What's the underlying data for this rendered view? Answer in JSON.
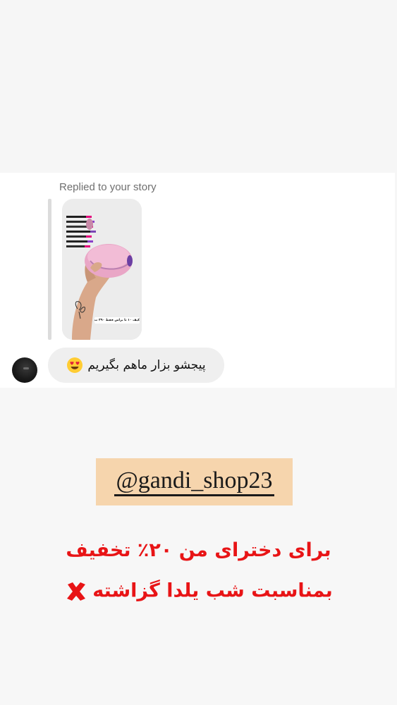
{
  "story_reply": {
    "label": "Replied to your story",
    "story_caption": "کیف ۱۰ تا براش فقط ۳۹۰ ت 😍❌"
  },
  "message": {
    "text": "پیجشو بزار ماهم بگیریم",
    "emoji": "heart-eyes-emoji"
  },
  "promo": {
    "handle": "@gandi_shop23",
    "line1": "برای دخترای من ۲۰٪ تخفیف",
    "line2": "بمناسبت شب یلدا گزاشته",
    "line2_icon": "cross-mark-icon"
  },
  "colors": {
    "promo_text": "#e81416",
    "handle_bg": "#f6d5ad",
    "bubble_bg": "#efefef",
    "label_gray": "#6f6f6f"
  }
}
